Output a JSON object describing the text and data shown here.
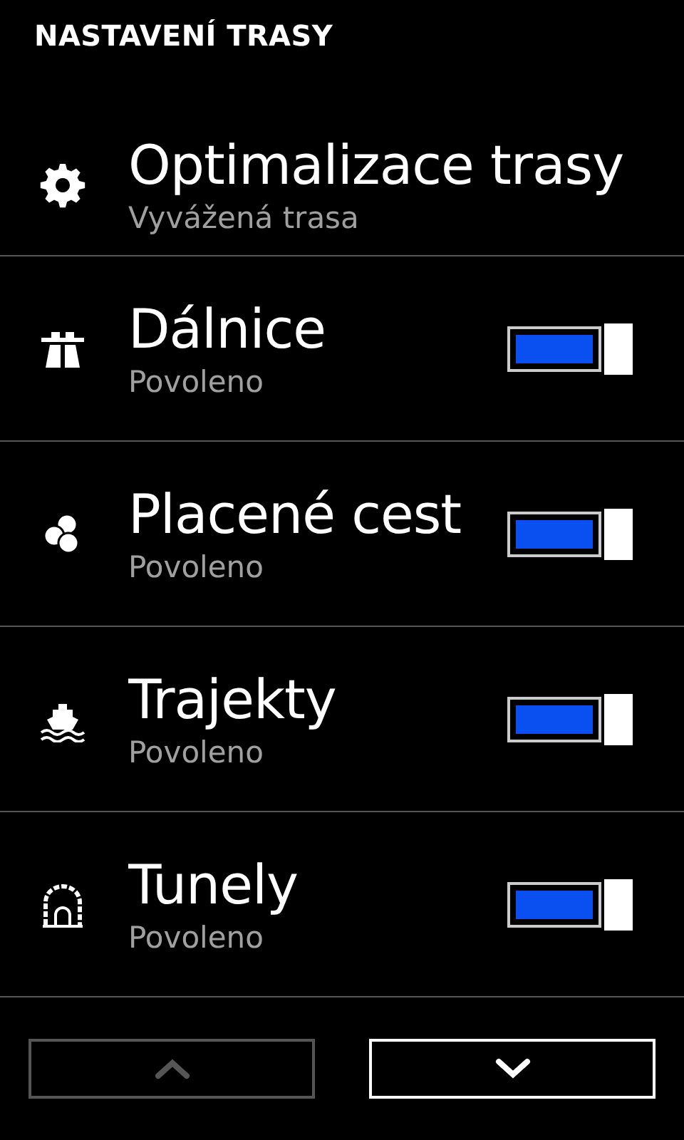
{
  "header": {
    "title": "NASTAVENÍ TRASY"
  },
  "settings": [
    {
      "kind": "picker",
      "title": "Optimalizace trasy",
      "value": "Vyvážená trasa"
    },
    {
      "kind": "toggle",
      "title": "Dálnice",
      "value": "Povoleno",
      "on": true
    },
    {
      "kind": "toggle",
      "title": "Placené cest",
      "value": "Povoleno",
      "on": true
    },
    {
      "kind": "toggle",
      "title": "Trajekty",
      "value": "Povoleno",
      "on": true
    },
    {
      "kind": "toggle",
      "title": "Tunely",
      "value": "Povoleno",
      "on": true
    }
  ],
  "nav_buttons": [
    {
      "disabled": true
    },
    {
      "disabled": false
    }
  ]
}
